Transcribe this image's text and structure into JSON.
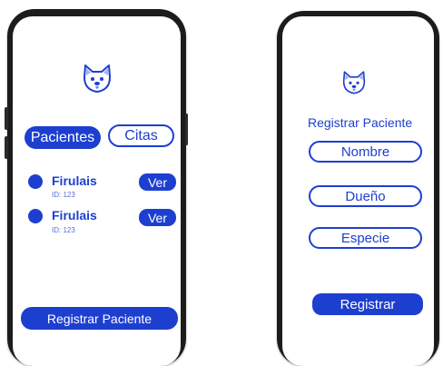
{
  "colors": {
    "accent": "#1d3fd0",
    "frame": "#1c1c1c"
  },
  "screen1": {
    "logo_icon": "dog-face-icon",
    "tabs": [
      {
        "label": "Pacientes",
        "active": true
      },
      {
        "label": "Citas",
        "active": false
      }
    ],
    "patients": [
      {
        "name": "Firulais",
        "id": "ID: 123",
        "action": "Ver"
      },
      {
        "name": "Firulais",
        "id": "ID: 123",
        "action": "Ver"
      }
    ],
    "register_button": "Registrar Paciente"
  },
  "screen2": {
    "logo_icon": "dog-face-icon",
    "title": "Registrar Paciente",
    "fields": {
      "name": "Nombre",
      "owner": "Dueño",
      "species": "Especie"
    },
    "submit_button": "Registrar"
  }
}
